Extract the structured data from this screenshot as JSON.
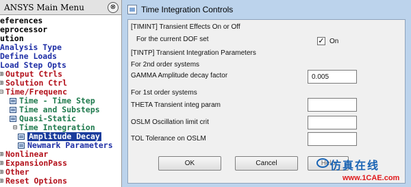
{
  "main_menu": {
    "title": "ANSYS Main Menu",
    "collapse_icon": "⊗",
    "items": [
      {
        "label": "Preferences",
        "shown": "eferences",
        "color": "#000000"
      },
      {
        "label": "Preprocessor",
        "shown": "eprocessor",
        "color": "#000000"
      },
      {
        "label": "Solution",
        "shown": "ution",
        "color": "#000000"
      },
      {
        "label": "Analysis Type",
        "shown": "Analysis Type",
        "color": "#1f2fa6"
      },
      {
        "label": "Define Loads",
        "shown": "Define Loads",
        "color": "#1f2fa6"
      },
      {
        "label": "Load Step Opts",
        "shown": "Load Step Opts",
        "color": "#1f2fa6"
      },
      {
        "label": "Output Ctrls",
        "shown": "Output Ctrls",
        "color": "#b3111b"
      },
      {
        "label": "Solution Ctrl",
        "shown": "Solution Ctrl",
        "color": "#b3111b"
      },
      {
        "label": "Time/Frequenc",
        "shown": "Time/Frequenc",
        "color": "#b3111b"
      },
      {
        "label": "Time - Time Step",
        "shown": "Time - Time Step",
        "color": "#1f7a4d"
      },
      {
        "label": "Time and Substeps",
        "shown": "Time and Substeps",
        "color": "#1f7a4d"
      },
      {
        "label": "Quasi-Static",
        "shown": "Quasi-Static",
        "color": "#1f7a4d"
      },
      {
        "label": "Time Integration",
        "shown": "Time Integration",
        "color": "#1f7a4d"
      },
      {
        "label": "Amplitude Decay",
        "shown": "Amplitude Decay",
        "color": "#ffffff"
      },
      {
        "label": "Newmark Parameters",
        "shown": "Newmark Parameters",
        "color": "#1f2fa6"
      },
      {
        "label": "Nonlinear",
        "shown": "Nonlinear",
        "color": "#b3111b"
      },
      {
        "label": "ExpansionPass",
        "shown": "ExpansionPass",
        "color": "#b3111b"
      },
      {
        "label": "Other",
        "shown": "Other",
        "color": "#b3111b"
      },
      {
        "label": "Reset Options",
        "shown": "Reset Options",
        "color": "#b3111b"
      }
    ]
  },
  "dialog": {
    "title": "Time Integration Controls",
    "timint_label": "[TIMINT]  Transient Effects On or Off",
    "dof_label": "For the current DOF set",
    "dof_checked": true,
    "dof_check_mark": "✓",
    "on_label": "On",
    "tintp_label": "[TINTP]  Transient Integration Parameters",
    "second_order_label": "For 2nd order systems",
    "gamma_label": "GAMMA    Amplitude decay factor",
    "gamma_value": "0.005",
    "first_order_label": "For 1st order systems",
    "theta_label": "THETA  Transient integ param",
    "theta_value": "",
    "oslm_label": "OSLM    Oscillation limit crit",
    "oslm_value": "",
    "tol_label": "TOL    Tolerance on OSLM",
    "tol_value": "",
    "ok_label": "OK",
    "cancel_label": "Cancel",
    "help_label": "Help"
  },
  "watermark": {
    "cn_text": "仿真在线",
    "url": "www.1CAE.com"
  }
}
